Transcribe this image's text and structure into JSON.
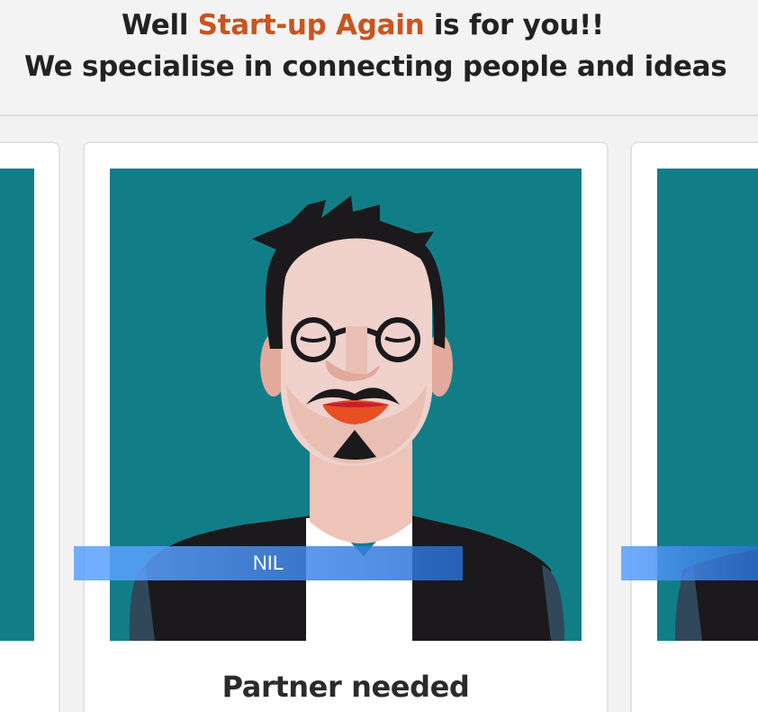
{
  "hero": {
    "line1_prefix": "Well ",
    "line1_brand": "Start-up Again",
    "line1_suffix": " is for you!!",
    "line2": "We specialise in connecting people and ideas"
  },
  "cards": {
    "featured": {
      "tag": "NIL",
      "title": "Partner needed",
      "avatar": "avatar-man-glasses-icon"
    }
  },
  "colors": {
    "brand": "#c9541e",
    "photo_bg": "#117e87",
    "tag_bar": "#2d7ad6"
  }
}
